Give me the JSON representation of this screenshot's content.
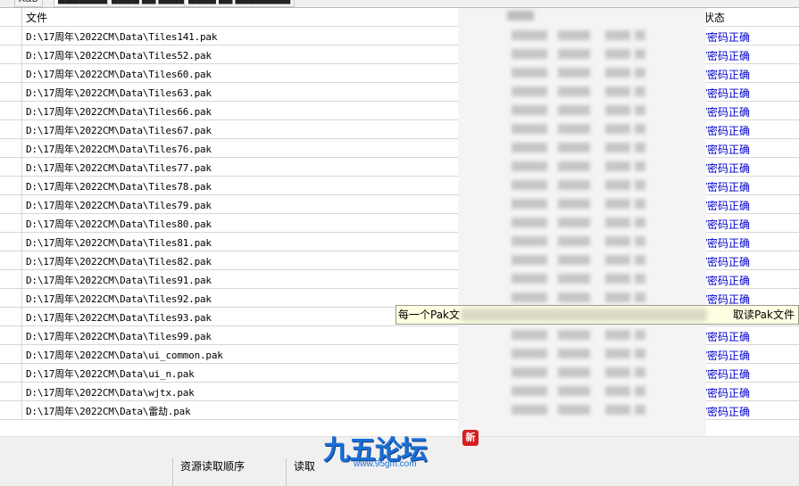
{
  "tabs": [
    {
      "label": "A&B"
    },
    {
      "label": "████████ ███"
    },
    {
      "label": "████ ██ ████ ███"
    },
    {
      "label": "████ ██ ████████"
    }
  ],
  "table": {
    "columns": {
      "file": "文件",
      "status": "状态"
    },
    "status_visible": "/密码正确",
    "rows": [
      {
        "path": "D:\\17周年\\2022CM\\Data\\Tiles141.pak",
        "status": "/密码正确"
      },
      {
        "path": "D:\\17周年\\2022CM\\Data\\Tiles52.pak",
        "status": "/密码正确"
      },
      {
        "path": "D:\\17周年\\2022CM\\Data\\Tiles60.pak",
        "status": "/密码正确"
      },
      {
        "path": "D:\\17周年\\2022CM\\Data\\Tiles63.pak",
        "status": "/密码正确"
      },
      {
        "path": "D:\\17周年\\2022CM\\Data\\Tiles66.pak",
        "status": "/密码正确"
      },
      {
        "path": "D:\\17周年\\2022CM\\Data\\Tiles67.pak",
        "status": "/密码正确"
      },
      {
        "path": "D:\\17周年\\2022CM\\Data\\Tiles76.pak",
        "status": "/密码正确"
      },
      {
        "path": "D:\\17周年\\2022CM\\Data\\Tiles77.pak",
        "status": "/密码正确"
      },
      {
        "path": "D:\\17周年\\2022CM\\Data\\Tiles78.pak",
        "status": "/密码正确"
      },
      {
        "path": "D:\\17周年\\2022CM\\Data\\Tiles79.pak",
        "status": "/密码正确"
      },
      {
        "path": "D:\\17周年\\2022CM\\Data\\Tiles80.pak",
        "status": "/密码正确"
      },
      {
        "path": "D:\\17周年\\2022CM\\Data\\Tiles81.pak",
        "status": "/密码正确"
      },
      {
        "path": "D:\\17周年\\2022CM\\Data\\Tiles82.pak",
        "status": "/密码正确"
      },
      {
        "path": "D:\\17周年\\2022CM\\Data\\Tiles91.pak",
        "status": "/密码正确"
      },
      {
        "path": "D:\\17周年\\2022CM\\Data\\Tiles92.pak",
        "status": "/密码正确"
      },
      {
        "path": "D:\\17周年\\2022CM\\Data\\Tiles93.pak",
        "status": "取读Pak文件"
      },
      {
        "path": "D:\\17周年\\2022CM\\Data\\Tiles99.pak",
        "status": "/密码正确"
      },
      {
        "path": "D:\\17周年\\2022CM\\Data\\ui_common.pak",
        "status": "/密码正确"
      },
      {
        "path": "D:\\17周年\\2022CM\\Data\\ui_n.pak",
        "status": "/密码正确"
      },
      {
        "path": "D:\\17周年\\2022CM\\Data\\wjtx.pak",
        "status": "/密码正确"
      },
      {
        "path": "D:\\17周年\\2022CM\\Data\\雷劫.pak",
        "status": "/密码正确"
      }
    ]
  },
  "tooltip": {
    "left": "每一个Pak文",
    "right": "取读Pak文件"
  },
  "panel": {
    "load_order": "资源读取顺序",
    "read_label": "读取"
  },
  "watermark": {
    "logo": "九五论坛",
    "url": "www.95gm.com",
    "seal": "新"
  },
  "colors": {
    "status_blue": "#0000cc",
    "tooltip_bg": "#ffffe1",
    "logo_blue": "#1a6fd6"
  }
}
